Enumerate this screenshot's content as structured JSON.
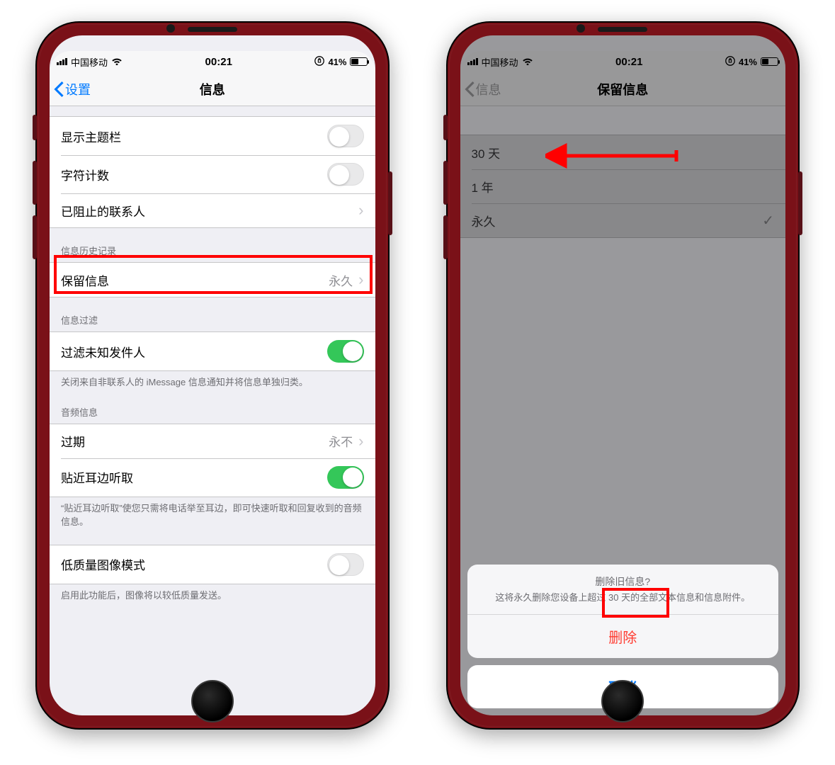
{
  "status": {
    "carrier": "中国移动",
    "time": "00:21",
    "battery_text": "41%"
  },
  "left_phone": {
    "nav": {
      "back": "设置",
      "title": "信息"
    },
    "cells": {
      "show_subject": "显示主题栏",
      "char_count": "字符计数",
      "blocked": "已阻止的联系人",
      "history_header": "信息历史记录",
      "keep_messages": "保留信息",
      "keep_messages_value": "永久",
      "filter_header": "信息过滤",
      "filter_unknown": "过滤未知发件人",
      "filter_footer": "关闭来自非联系人的 iMessage 信息通知并将信息单独归类。",
      "audio_header": "音频信息",
      "expire": "过期",
      "expire_value": "永不",
      "raise_listen": "贴近耳边听取",
      "raise_footer": "“贴近耳边听取”使您只需将电话举至耳边，即可快速听取和回复收到的音频信息。",
      "low_quality": "低质量图像模式",
      "low_quality_footer": "启用此功能后，图像将以较低质量发送。"
    }
  },
  "right_phone": {
    "nav": {
      "back": "信息",
      "title": "保留信息"
    },
    "options": {
      "opt1": "30 天",
      "opt2": "1 年",
      "opt3": "永久"
    },
    "sheet": {
      "title": "删除旧信息?",
      "desc": "这将永久删除您设备上超过 30 天的全部文本信息和信息附件。",
      "delete": "删除",
      "cancel": "取消"
    }
  }
}
